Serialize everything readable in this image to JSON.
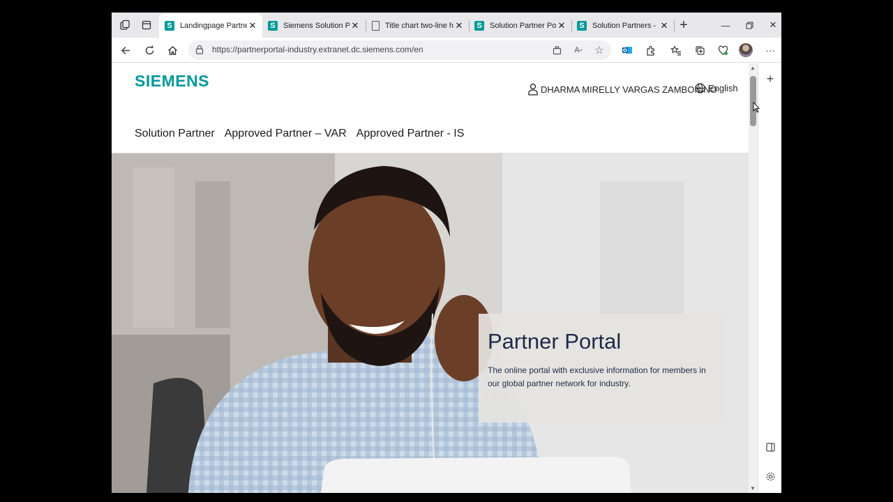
{
  "browser": {
    "tabs": [
      {
        "title": "Landingpage Partner Portal",
        "favicon": "S",
        "active": true
      },
      {
        "title": "Siemens Solution Partner",
        "favicon": "S",
        "active": false
      },
      {
        "title": "Title chart two-line header",
        "favicon": "doc",
        "active": false
      },
      {
        "title": "Solution Partner Portal –",
        "favicon": "S",
        "active": false
      },
      {
        "title": "Solution Partners - Partner",
        "favicon": "S",
        "active": false
      }
    ],
    "url": "https://partnerportal-industry.extranet.dc.siemens.com/en"
  },
  "page": {
    "logo": "SIEMENS",
    "user_name": "DHARMA MIRELLY VARGAS ZAMBONINO",
    "language": "English",
    "nav": [
      "Solution Partner",
      "Approved Partner – VAR",
      "Approved Partner - IS"
    ],
    "hero_title": "Partner Portal",
    "hero_text": "The online portal with exclusive information for members in our global partner network for industry."
  },
  "colors": {
    "brand": "#009999",
    "heading": "#1d2a4a"
  }
}
